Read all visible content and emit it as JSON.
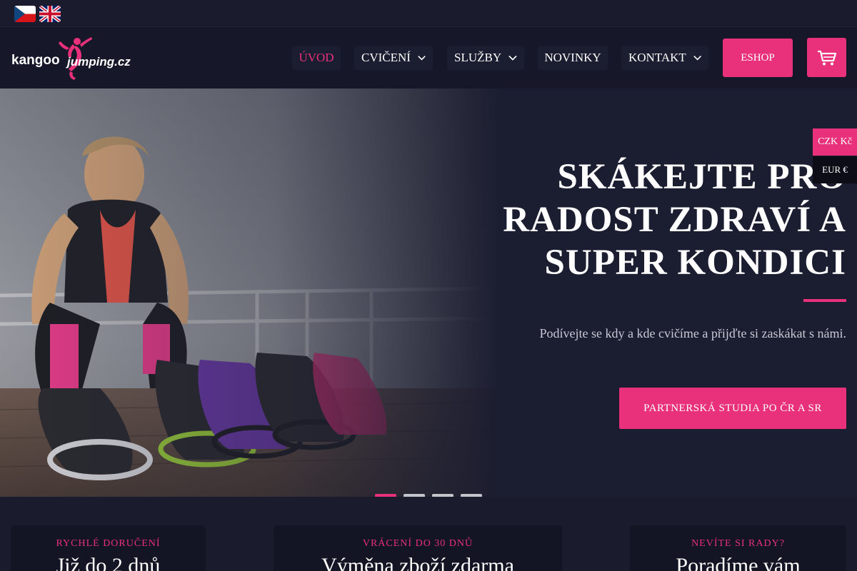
{
  "languages": [
    {
      "code": "cs",
      "icon": "czech-flag-icon"
    },
    {
      "code": "en",
      "icon": "uk-flag-icon"
    }
  ],
  "brand": {
    "logo_text_left": "kangoo",
    "logo_text_right": "jumping.cz",
    "accent_color": "#e8317a"
  },
  "nav": {
    "uvod": "ÚVOD",
    "cviceni": "CVIČENÍ",
    "sluzby": "SLUŽBY",
    "novinky": "NOVINKY",
    "kontakt": "KONTAKT",
    "eshop": "ESHOP"
  },
  "hero": {
    "title_lines": [
      "SKÁKEJTE PRO",
      "RADOST ZDRAVÍ A",
      "SUPER KONDICI"
    ],
    "subtitle": "Podívejte se kdy a kde cvičíme a přijďte si zaskákat s námi.",
    "cta": "PARTNERSKÁ STUDIA PO ČR A SR",
    "slides": 4,
    "active_slide": 1
  },
  "currency": {
    "czk": "CZK Kč",
    "eur": "EUR €",
    "selected": "CZK Kč"
  },
  "cards": [
    {
      "kicker": "RYCHLÉ DORUČENÍ",
      "title": "Již do 2 dnů"
    },
    {
      "kicker": "VRÁCENÍ DO 30 DNŮ",
      "title": "Výměna zboží zdarma"
    },
    {
      "kicker": "NEVÍTE SI RADY?",
      "title": "Poradíme vám"
    }
  ]
}
